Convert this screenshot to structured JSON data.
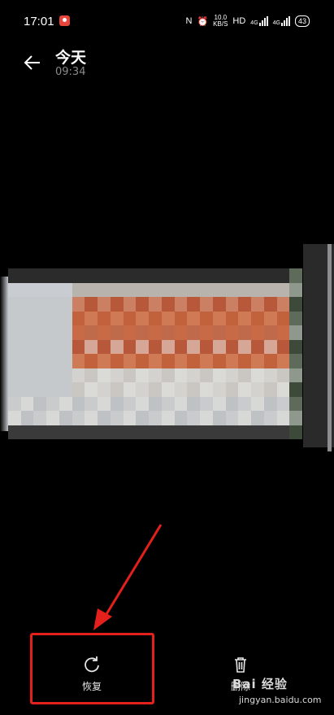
{
  "status_bar": {
    "time": "17:01",
    "network_speed_value": "10.0",
    "network_speed_unit": "KB/S",
    "hd_label": "HD",
    "signal_1": "4G",
    "signal_2": "4G",
    "battery": "43"
  },
  "header": {
    "title": "今天",
    "subtitle": "09:34"
  },
  "actions": {
    "restore_label": "恢复",
    "delete_label": "删除"
  },
  "watermark": {
    "brand": "Bai 经验",
    "url": "jingyan.baidu.com"
  },
  "annotation_color": "#e3201b"
}
